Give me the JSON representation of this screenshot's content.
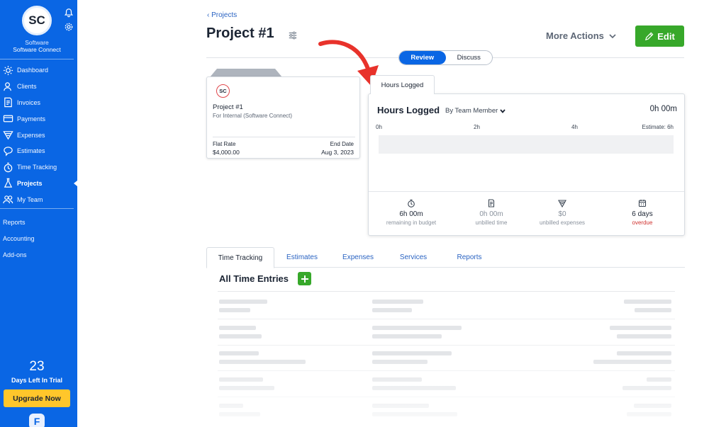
{
  "sidebar": {
    "avatar_initials": "SC",
    "company_line1": "Software",
    "company_line2": "Software Connect",
    "nav": [
      {
        "label": "Dashboard",
        "icon": "dashboard-icon"
      },
      {
        "label": "Clients",
        "icon": "clients-icon"
      },
      {
        "label": "Invoices",
        "icon": "invoices-icon"
      },
      {
        "label": "Payments",
        "icon": "payments-icon"
      },
      {
        "label": "Expenses",
        "icon": "expenses-icon"
      },
      {
        "label": "Estimates",
        "icon": "estimates-icon"
      },
      {
        "label": "Time Tracking",
        "icon": "time-tracking-icon"
      },
      {
        "label": "Projects",
        "icon": "projects-icon",
        "active": true
      },
      {
        "label": "My Team",
        "icon": "team-icon"
      }
    ],
    "secondary": [
      "Reports",
      "Accounting",
      "Add-ons"
    ],
    "trial_days": "23",
    "trial_text": "Days Left In Trial",
    "upgrade_label": "Upgrade Now",
    "logo_letter": "F"
  },
  "header": {
    "back_label": "Projects",
    "title": "Project #1",
    "more_actions": "More Actions",
    "edit_label": "Edit",
    "toggle": {
      "review": "Review",
      "discuss": "Discuss",
      "selected": "Review"
    }
  },
  "project_card": {
    "initials": "SC",
    "name": "Project #1",
    "client": "For Internal (Software Connect)",
    "rate_label": "Flat Rate",
    "rate_value": "$4,000.00",
    "end_label": "End Date",
    "end_value": "Aug 3, 2023"
  },
  "hours": {
    "tab_label": "Hours Logged",
    "title": "Hours Logged",
    "group_by": "By Team Member",
    "total": "0h 00m",
    "ticks": [
      "0h",
      "2h",
      "4h"
    ],
    "estimate": "Estimate: 6h",
    "stats": [
      {
        "value": "6h 00m",
        "label": "remaining in budget",
        "icon": "stopwatch-icon"
      },
      {
        "value": "0h 00m",
        "label": "unbilled time",
        "icon": "invoice-icon"
      },
      {
        "value": "$0",
        "label": "unbilled expenses",
        "icon": "expense-icon"
      },
      {
        "value": "6 days",
        "label": "overdue",
        "icon": "calendar-icon"
      }
    ]
  },
  "tabs": [
    "Time Tracking",
    "Estimates",
    "Expenses",
    "Services",
    "Reports"
  ],
  "entries_title": "All Time Entries",
  "colors": {
    "brand_blue": "#0a66e4",
    "success_green": "#37a82a",
    "upgrade_yellow": "#ffc62b",
    "arrow_red": "#e8322b",
    "overdue_red": "#d0322f"
  }
}
